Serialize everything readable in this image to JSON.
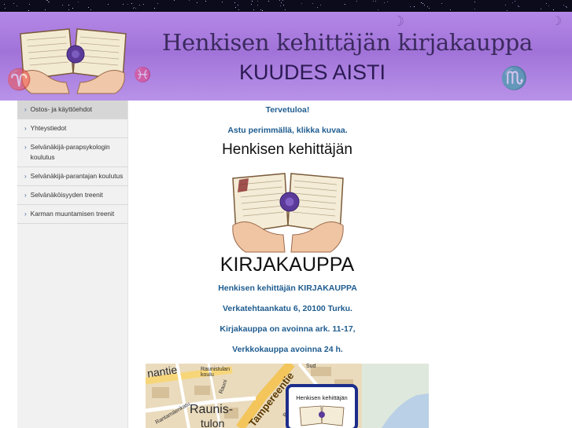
{
  "header": {
    "title": "Henkisen kehittäjän kirjakauppa",
    "subtitle": "KUUDES AISTI",
    "decorations": [
      "aries-glyph",
      "scorpio-glyph",
      "pisces-glyph"
    ]
  },
  "sidebar": {
    "items": [
      {
        "label": "Ostos- ja käyttöehdot",
        "active": true
      },
      {
        "label": "Yhteystiedot",
        "active": false
      },
      {
        "label": "Selvänäkijä-parapsykologin koulutus",
        "active": false
      },
      {
        "label": "Selvänäkijä-parantajan koulutus",
        "active": false
      },
      {
        "label": "Selvänäköisyyden treenit",
        "active": false
      },
      {
        "label": "Karman muuntamisen treenit",
        "active": false
      }
    ]
  },
  "content": {
    "welcome": "Tervetuloa!",
    "instruction": "Astu perimmällä, klikka kuvaa.",
    "logo_top": "Henkisen kehittäjän",
    "logo_bottom": "KIRJAKAUPPA",
    "shop_name": "Henkisen kehittäjän KIRJAKAUPPA",
    "address": "Verkatehtaankatu 6, 20100 Turku.",
    "hours_store": "Kirjakauppa on avoinna ark. 11-17,",
    "hours_online": "Verkkokauppa avoinna 24 h."
  },
  "map": {
    "labels": [
      "nantie",
      "Raunistulan koulu",
      "Rauni",
      "Raunis-",
      "tulon",
      "Tampereentie",
      "Sud",
      "Rauhank",
      "Rantamäenkatu"
    ],
    "badge_text": "Henkisen kehittäjän"
  },
  "colors": {
    "banner": "#a173d9",
    "link": "#1f5c8f",
    "chevron": "#3a5e9e",
    "badge_border": "#1c2d8a"
  }
}
